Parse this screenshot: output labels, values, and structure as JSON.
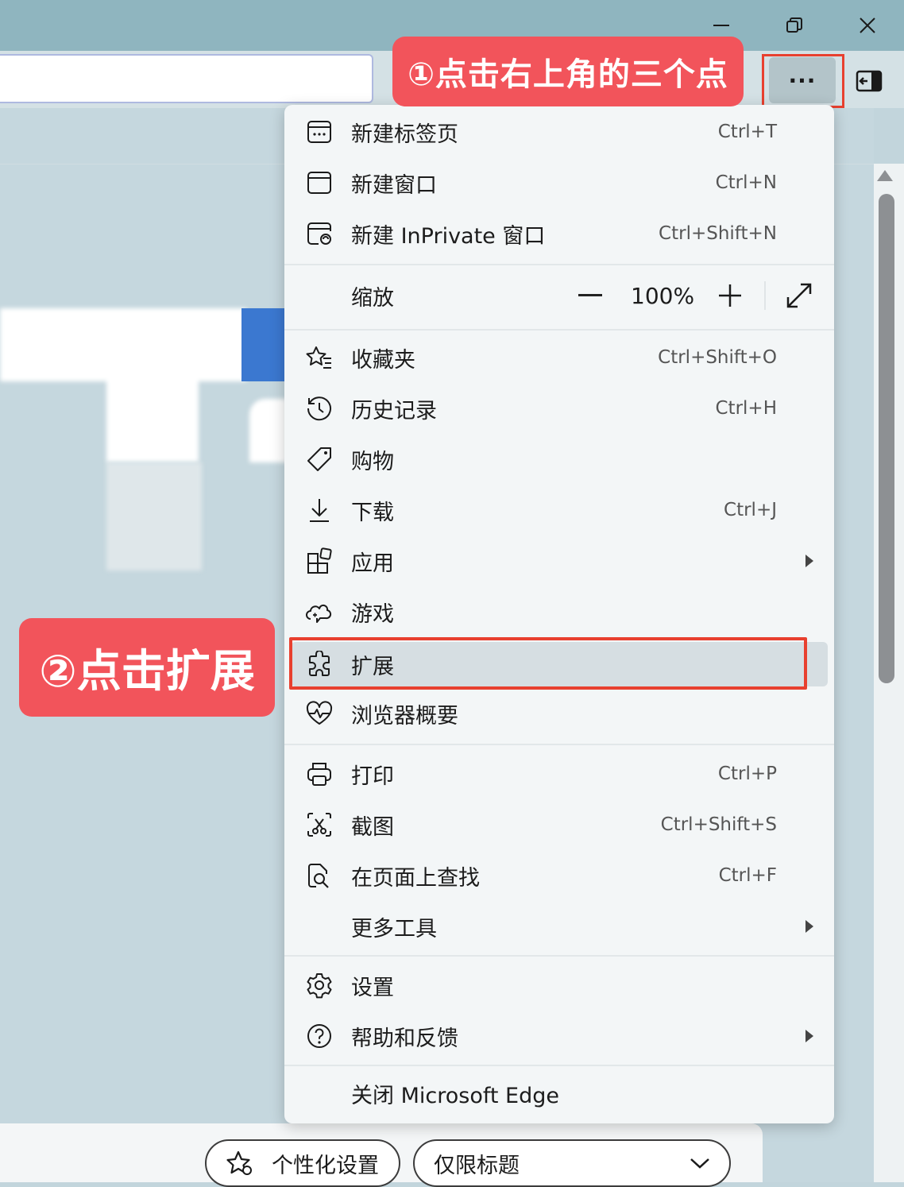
{
  "callouts": {
    "step1": "①点击右上角的三个点",
    "step2": "②点击扩展"
  },
  "window": {
    "minimize_icon": "minimize-icon",
    "restore_icon": "restore-icon",
    "close_icon": "close-icon"
  },
  "toolbar": {
    "more_button": "···"
  },
  "menu": {
    "new_tab": {
      "label": "新建标签页",
      "shortcut": "Ctrl+T"
    },
    "new_window": {
      "label": "新建窗口",
      "shortcut": "Ctrl+N"
    },
    "new_inprivate": {
      "label": "新建 InPrivate 窗口",
      "shortcut": "Ctrl+Shift+N"
    },
    "zoom": {
      "label": "缩放",
      "value": "100%"
    },
    "favorites": {
      "label": "收藏夹",
      "shortcut": "Ctrl+Shift+O"
    },
    "history": {
      "label": "历史记录",
      "shortcut": "Ctrl+H"
    },
    "shopping": {
      "label": "购物"
    },
    "downloads": {
      "label": "下载",
      "shortcut": "Ctrl+J"
    },
    "apps": {
      "label": "应用"
    },
    "games": {
      "label": "游戏"
    },
    "extensions": {
      "label": "扩展"
    },
    "browser_essentials": {
      "label": "浏览器概要"
    },
    "print": {
      "label": "打印",
      "shortcut": "Ctrl+P"
    },
    "screenshot": {
      "label": "截图",
      "shortcut": "Ctrl+Shift+S"
    },
    "find": {
      "label": "在页面上查找",
      "shortcut": "Ctrl+F"
    },
    "more_tools": {
      "label": "更多工具"
    },
    "settings": {
      "label": "设置"
    },
    "help": {
      "label": "帮助和反馈"
    },
    "close_edge": {
      "label": "关闭 Microsoft Edge"
    }
  },
  "bottom": {
    "personalize": "个性化设置",
    "headline": "仅限标题"
  },
  "colors": {
    "callout": "#f2545b",
    "highlight": "#e8402f",
    "titlebar": "#8fb5bf"
  }
}
